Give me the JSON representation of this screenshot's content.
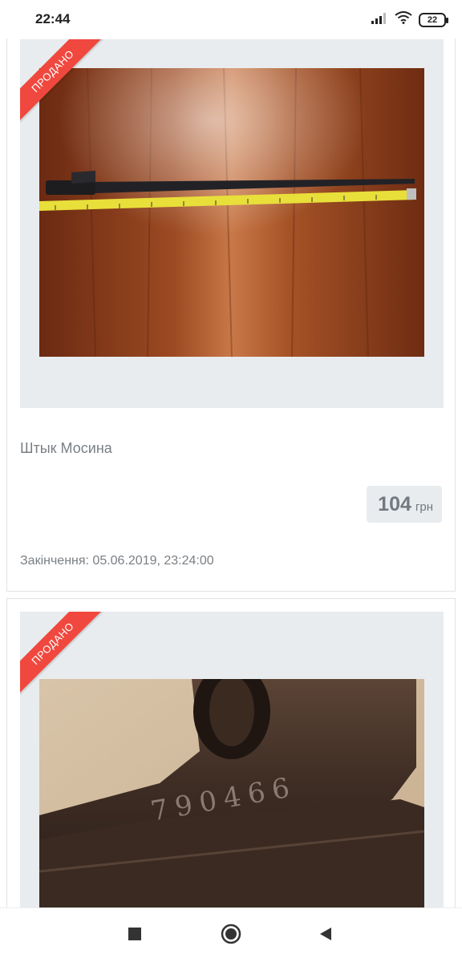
{
  "status_bar": {
    "time": "22:44",
    "battery": "22",
    "icons": [
      "signal-icon",
      "wifi-icon",
      "battery-icon"
    ]
  },
  "listings": [
    {
      "badge": "ПРОДАНО",
      "title": "Штык Мосина",
      "price_value": "104",
      "price_currency": "грн",
      "end_time": "Закінчення: 05.06.2019, 23:24:00"
    },
    {
      "badge": "ПРОДАНО",
      "stamp": "790466"
    }
  ],
  "colors": {
    "ribbon": "#f0483e",
    "frame_bg": "#e9ecee",
    "muted_text": "#7a7f84"
  },
  "nav_bar": {
    "icons": [
      "recent-apps-icon",
      "home-icon",
      "back-icon"
    ]
  }
}
